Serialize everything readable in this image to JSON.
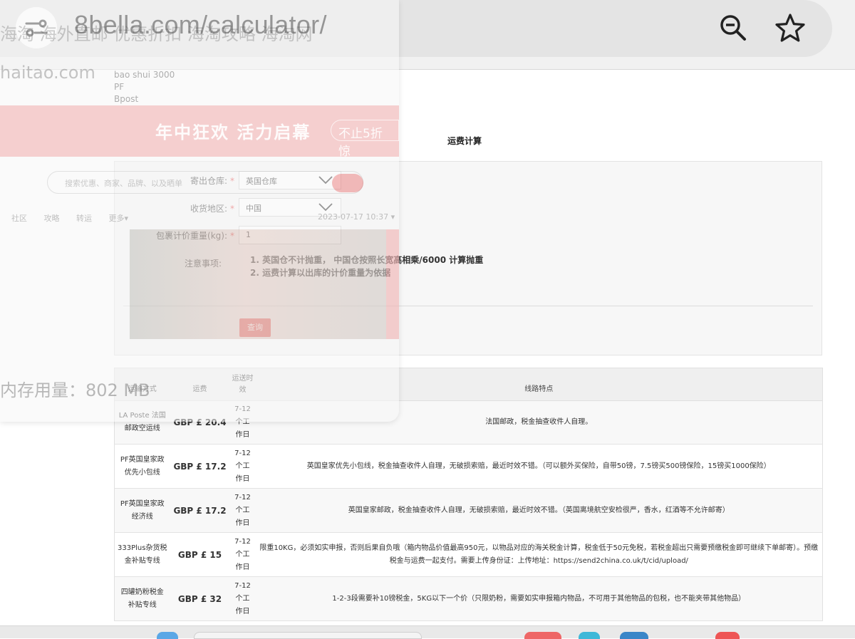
{
  "browser": {
    "url": "8bella.com/calculator/"
  },
  "ghost": {
    "title": "海淘  海外直邮 优惠折扣 海淘攻略 海淘网",
    "domain": "haitao.com",
    "banner_text": "年中狂欢 活力启幕",
    "banner_tag": "不止5折 惊",
    "search_placeholder": "搜索优惠、商家、品牌、以及晒单",
    "nav": "社区 攻略 转运 更多▾",
    "nav_right": "2023-07-17 10:37 ▾",
    "memory": "内存用量：802 MB"
  },
  "toplinks": [
    "bao shui 3000",
    "PF",
    "Bpost"
  ],
  "calculator": {
    "title": "运费计算",
    "fields": {
      "warehouse_label": "寄出仓库:",
      "warehouse_value": "英国仓库",
      "region_label": "收货地区:",
      "region_value": "中国",
      "weight_label": "包裹计价重量(kg):",
      "weight_value": "1",
      "notes_label": "注意事项:"
    },
    "notes": [
      "1. 英国仓不计抛重，  中国仓按照长宽高相乘/6000 计算抛重",
      "2. 运费计算以出库的计价重量为依据"
    ],
    "query_button": "查询"
  },
  "table": {
    "headers": [
      "运输方式",
      "运费",
      "运送时效",
      "线路特点"
    ],
    "rows": [
      {
        "method": "LA Poste 法国邮政空运线",
        "price": "GBP £ 20.4",
        "time": "7-12个工作日",
        "desc": "法国邮政，税金抽查收件人自理。"
      },
      {
        "method": "PF英国皇家政优先小包线",
        "price": "GBP £ 17.2",
        "time": "7-12个工作日",
        "desc": "英国皇家优先小包线，税金抽查收件人自理，无破损索赔，最近时效不错。（可以额外买保险，自带50镑，7.5镑买500镑保险，15镑买1000保险）"
      },
      {
        "method": "PF英国皇家政经济线",
        "price": "GBP £ 17.2",
        "time": "7-12个工作日",
        "desc": "英国皇家邮政，税金抽查收件人自理，无破损索赔，最近时效不错。（英国离境航空安检很严，香水，红酒等不允许邮寄）"
      },
      {
        "method": "333Plus杂货税金补贴专线",
        "price": "GBP £ 15",
        "time": "7-12个工作日",
        "desc": "限重10KG，必须如实申报，否则后果自负哦（箱内物品价值最高950元，以物品对应的海关税金计算，税金低于50元免税，若税金超出只需要预缴税金即可继续下单邮寄）。预缴税金与运费一起支付。需要上传身份证：上传地址：https://send2china.co.uk/t/cid/upload/"
      },
      {
        "method": "四罐奶粉税金补贴专线",
        "price": "GBP £ 32",
        "time": "7-12个工作日",
        "desc": "1-2-3段需要补10镑税金，5KG以下一个价（只限奶粉，需要如实申报箱内物品，不可用于其他物品的包税，也不能夹带其他物品）"
      }
    ]
  },
  "colors": {
    "accent": "#ec6a6a",
    "required_star": "#e54b4b"
  },
  "icons": {
    "site_info": "tune-icon",
    "zoom": "zoom-out-icon",
    "bookmark": "star-icon",
    "select": "chevron-down-icon"
  }
}
